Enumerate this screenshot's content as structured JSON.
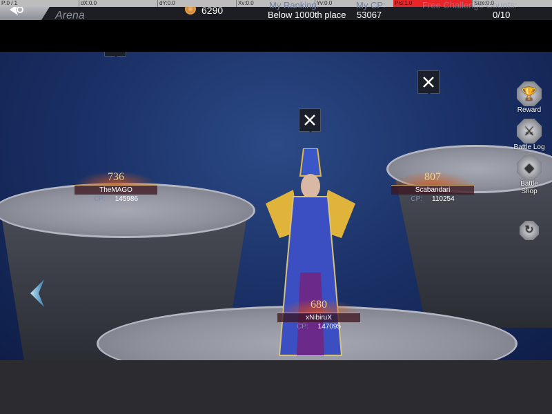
{
  "debug": {
    "p": "P:0 / 1",
    "dx": "dX:0.0",
    "dy": "dY:0.0",
    "xv": "Xv:0.0",
    "yv": "Yv:0.0",
    "prs": "Prs:1.0",
    "size": "Size:0.0"
  },
  "header": {
    "title": "Arena",
    "currency": "6290",
    "ranking_label": "My Ranking:",
    "ranking_value": "Below 1000th place",
    "cp_label": "My CP:",
    "cp_value": "53067",
    "challenge_label": "Free Challenge Counts:",
    "challenge_value": "0/10"
  },
  "opponents": [
    {
      "rank": "736",
      "name": "TheMAGO",
      "cp_label": "CP:",
      "cp": "145986"
    },
    {
      "rank": "807",
      "name": "Scabandari",
      "cp_label": "CP:",
      "cp": "110254"
    },
    {
      "rank": "680",
      "name": "xNibiruX",
      "cp_label": "CP:",
      "cp": "147095"
    }
  ],
  "side_menu": [
    {
      "label": "Reward",
      "icon": "trophy-icon"
    },
    {
      "label": "Battle Log",
      "icon": "battle-log-icon"
    },
    {
      "label": "Battle Shop",
      "icon": "diamond-icon"
    }
  ],
  "colors": {
    "accent": "#f4d38a",
    "debug_red": "#e8262a"
  }
}
